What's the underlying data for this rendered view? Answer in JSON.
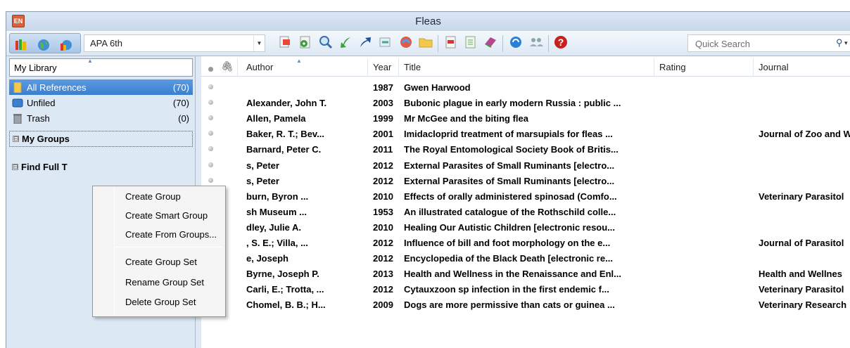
{
  "window": {
    "app_badge": "EN",
    "title": "Fleas"
  },
  "toolbar": {
    "citation_style": "APA 6th",
    "quick_search_placeholder": "Quick Search",
    "left_icons": [
      "library-books-icon",
      "globe-icon",
      "online-library-icon"
    ],
    "icons": [
      "insert-citation-icon",
      "format-bibliography-icon",
      "find-references-icon",
      "go-back-icon",
      "go-forward-icon",
      "link-icon",
      "open-url-icon",
      "open-folder-icon",
      "pdf-icon",
      "edit-icon",
      "word-icon",
      "sync-icon",
      "share-icon",
      "help-icon"
    ],
    "search_dropdown_arrow": "▾"
  },
  "sidebar": {
    "library_label": "My Library",
    "items": [
      {
        "label": "All References",
        "count": "(70)",
        "icon": "folder-all-icon"
      },
      {
        "label": "Unfiled",
        "count": "(70)",
        "icon": "unfiled-icon"
      },
      {
        "label": "Trash",
        "count": "(0)",
        "icon": "trash-icon"
      }
    ],
    "groups": [
      {
        "label": "My Groups",
        "expander": "⊟"
      },
      {
        "label": "Find Full T",
        "expander": "⊟"
      }
    ]
  },
  "table": {
    "columns": [
      "Author",
      "Year",
      "Title",
      "Rating",
      "Journal"
    ],
    "rows": [
      {
        "author": "",
        "year": "1987",
        "title": "Gwen Harwood",
        "journal": ""
      },
      {
        "author": "Alexander, John T.",
        "year": "2003",
        "title": "Bubonic plague in early modern Russia : public ...",
        "journal": ""
      },
      {
        "author": "Allen, Pamela",
        "year": "1999",
        "title": "Mr McGee and the biting flea",
        "journal": ""
      },
      {
        "author": "Baker, R. T.; Bev...",
        "year": "2001",
        "title": "Imidacloprid treatment of marsupials for fleas ...",
        "journal": "Journal of Zoo and W"
      },
      {
        "author": "Barnard, Peter C.",
        "year": "2011",
        "title": "The Royal Entomological Society Book of Britis...",
        "journal": ""
      },
      {
        "author": "s, Peter",
        "year": "2012",
        "title": "External Parasites of Small Ruminants [electro...",
        "journal": ""
      },
      {
        "author": "s, Peter",
        "year": "2012",
        "title": "External Parasites of Small Ruminants [electro...",
        "journal": ""
      },
      {
        "author": "burn, Byron ...",
        "year": "2010",
        "title": "Effects of orally administered spinosad (Comfo...",
        "journal": "Veterinary Parasitol"
      },
      {
        "author": "sh Museum ...",
        "year": "1953",
        "title": "An illustrated catalogue of the Rothschild colle...",
        "journal": ""
      },
      {
        "author": "dley, Julie A.",
        "year": "2010",
        "title": "Healing Our Autistic Children [electronic resou...",
        "journal": ""
      },
      {
        "author": ", S. E.; Villa, ...",
        "year": "2012",
        "title": "Influence of bill and foot morphology on the e...",
        "journal": "Journal of Parasitol"
      },
      {
        "author": "e, Joseph",
        "year": "2012",
        "title": "Encyclopedia of the Black Death [electronic re...",
        "journal": ""
      },
      {
        "author": "Byrne, Joseph P.",
        "year": "2013",
        "title": "Health and Wellness in the Renaissance and Enl...",
        "journal": "Health and Wellnes"
      },
      {
        "author": "Carli, E.; Trotta, ...",
        "year": "2012",
        "title": "Cytauxzoon sp infection in the first endemic f...",
        "journal": "Veterinary Parasitol"
      },
      {
        "author": "Chomel, B. B.; H...",
        "year": "2009",
        "title": "Dogs are more permissive than cats or guinea ...",
        "journal": "Veterinary Research"
      }
    ]
  },
  "context_menu": {
    "items": [
      "Create Group",
      "Create Smart Group",
      "Create From Groups...",
      "Create Group Set",
      "Rename Group Set",
      "Delete Group Set"
    ]
  },
  "colors": {
    "selection": "#3a7fd0",
    "sidebar_bg": "#dde8f5",
    "help_red": "#c8201c"
  }
}
